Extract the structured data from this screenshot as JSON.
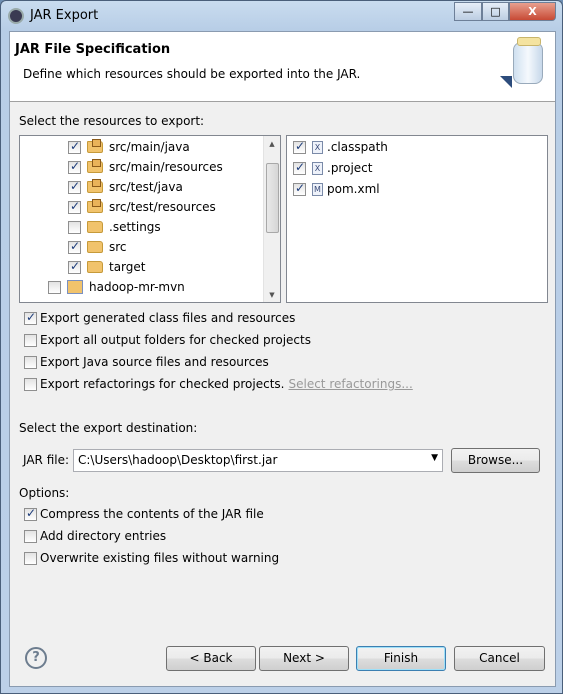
{
  "window": {
    "title": "JAR Export",
    "minimize": "—",
    "maximize": "□",
    "close": "X"
  },
  "header": {
    "title": "JAR File Specification",
    "description": "Define which resources should be exported into the JAR."
  },
  "resources": {
    "label": "Select the resources to export:",
    "tree": [
      {
        "label": "src/main/java",
        "checked": true,
        "icon": "package-folder-icon"
      },
      {
        "label": "src/main/resources",
        "checked": true,
        "icon": "package-folder-icon"
      },
      {
        "label": "src/test/java",
        "checked": true,
        "icon": "package-folder-icon"
      },
      {
        "label": "src/test/resources",
        "checked": true,
        "icon": "package-folder-icon"
      },
      {
        "label": ".settings",
        "checked": false,
        "icon": "folder-icon"
      },
      {
        "label": "src",
        "checked": true,
        "icon": "folder-icon"
      },
      {
        "label": "target",
        "checked": true,
        "icon": "folder-icon"
      },
      {
        "label": "hadoop-mr-mvn",
        "checked": false,
        "icon": "project-icon"
      }
    ],
    "files": [
      {
        "label": ".classpath",
        "checked": true,
        "icon": "xml-file-icon",
        "glyph": "X"
      },
      {
        "label": ".project",
        "checked": true,
        "icon": "xml-file-icon",
        "glyph": "X"
      },
      {
        "label": "pom.xml",
        "checked": true,
        "icon": "maven-file-icon",
        "glyph": "M"
      }
    ]
  },
  "export_options": [
    {
      "label": "Export generated class files and resources",
      "checked": true
    },
    {
      "label": "Export all output folders for checked projects",
      "checked": false
    },
    {
      "label": "Export Java source files and resources",
      "checked": false
    },
    {
      "label": "Export refactorings for checked projects.",
      "checked": false
    }
  ],
  "select_refactorings": "Select refactorings...",
  "destination": {
    "label": "Select the export destination:",
    "jar_label": "JAR file:",
    "value": "C:\\Users\\hadoop\\Desktop\\first.jar",
    "browse": "Browse..."
  },
  "options": {
    "label": "Options:",
    "items": [
      {
        "label": "Compress the contents of the JAR file",
        "checked": true
      },
      {
        "label": "Add directory entries",
        "checked": false
      },
      {
        "label": "Overwrite existing files without warning",
        "checked": false
      }
    ]
  },
  "footer": {
    "help": "?",
    "back": "< Back",
    "next": "Next >",
    "finish": "Finish",
    "cancel": "Cancel"
  }
}
